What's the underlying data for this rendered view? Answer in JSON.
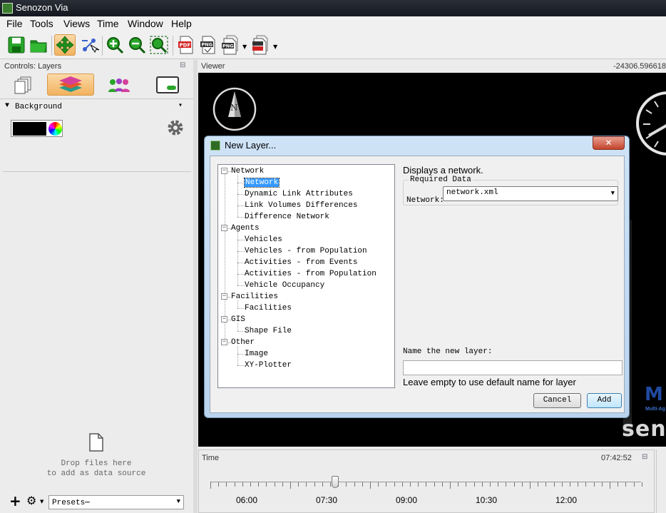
{
  "window": {
    "title": "Senozon Via"
  },
  "menu": [
    "File",
    "Tools",
    "Views",
    "Time",
    "Window",
    "Help"
  ],
  "left_panel": {
    "header": "Controls: Layers",
    "background_label": "Background",
    "drop_hint": "Drop files here\nto add as data source",
    "presets_label": "Presets⋯"
  },
  "viewer": {
    "header": "Viewer",
    "coordinate_readout": "-24306.596618",
    "compass_label": "N",
    "logo_text": "sen",
    "logo_top": "M",
    "logo_sub": "Multi-Ag"
  },
  "time_panel": {
    "header": "Time",
    "current_time": "07:42:52",
    "tick_labels": [
      "06:00",
      "07:30",
      "09:00",
      "10:30",
      "12:00"
    ],
    "slider_position": 0.29
  },
  "dialog": {
    "title": "New Layer...",
    "close_label": "✕",
    "tree": [
      {
        "label": "Network",
        "children": [
          "Network",
          "Dynamic Link Attributes",
          "Link Volumes Differences",
          "Difference Network"
        ]
      },
      {
        "label": "Agents",
        "children": [
          "Vehicles",
          "Vehicles - from Population",
          "Activities - from Events",
          "Activities - from Population",
          "Vehicle Occupancy"
        ]
      },
      {
        "label": "Facilities",
        "children": [
          "Facilities"
        ]
      },
      {
        "label": "GIS",
        "children": [
          "Shape File"
        ]
      },
      {
        "label": "Other",
        "children": [
          "Image",
          "XY-Plotter"
        ]
      }
    ],
    "selected_item": "Network",
    "description": "Displays a network.",
    "required_data_label": "Required Data",
    "network_field_label": "Network:",
    "network_value": "network.xml",
    "name_label": "Name the new layer:",
    "name_value": "",
    "name_hint": "Leave empty to use default name for layer",
    "cancel_label": "Cancel",
    "add_label": "Add"
  },
  "colors": {
    "background_swatch": "#000000",
    "selection": "#3399ff",
    "dialog_frame": "#b9d3ee",
    "active_tab": "#f2b25f"
  }
}
